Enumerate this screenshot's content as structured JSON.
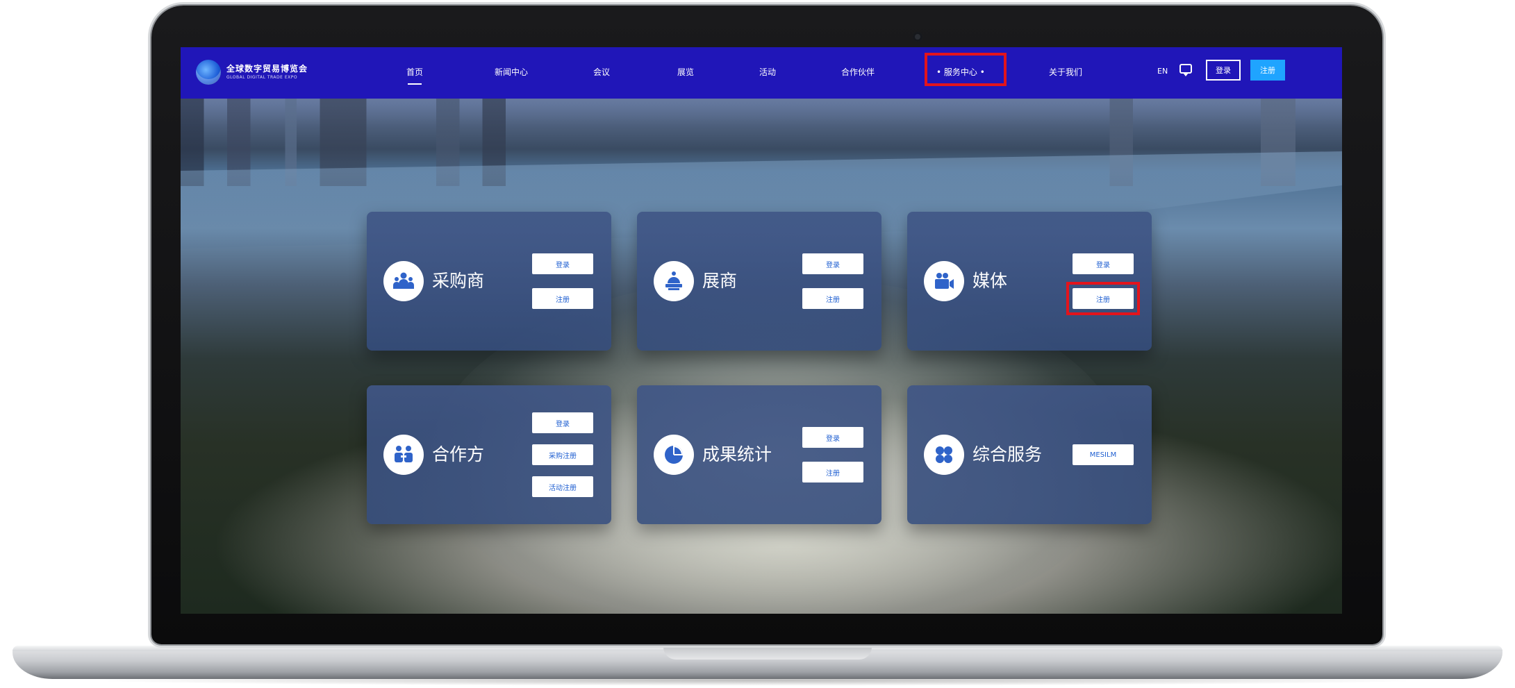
{
  "site": {
    "logo_cn": "全球数字贸易博览会",
    "logo_en": "GLOBAL DIGITAL TRADE EXPO"
  },
  "nav": {
    "items": [
      {
        "label": "首页"
      },
      {
        "label": "新闻中心"
      },
      {
        "label": "会议"
      },
      {
        "label": "展览"
      },
      {
        "label": "活动"
      },
      {
        "label": "合作伙伴"
      },
      {
        "label": "• 服务中心 •"
      },
      {
        "label": "关于我们"
      }
    ],
    "lang": "EN",
    "login": "登录",
    "register": "注册"
  },
  "cards": [
    {
      "title": "采购商",
      "buttons": [
        "登录",
        "注册"
      ]
    },
    {
      "title": "展商",
      "buttons": [
        "登录",
        "注册"
      ]
    },
    {
      "title": "媒体",
      "buttons": [
        "登录",
        "注册"
      ]
    },
    {
      "title": "合作方",
      "buttons": [
        "登录",
        "采购注册",
        "活动注册"
      ]
    },
    {
      "title": "成果统计",
      "buttons": [
        "登录",
        "注册"
      ]
    },
    {
      "title": "综合服务",
      "buttons": [
        "MESILM"
      ]
    }
  ],
  "colors": {
    "nav_bg": "#2016b8",
    "register_bg": "#1fa4ff",
    "highlight": "#e3141c",
    "card_button_text": "#1f5fd1"
  },
  "icons": {
    "buyer": "people-group-icon",
    "exhibitor": "cake-booth-icon",
    "media": "video-camera-icon",
    "partner": "handshake-people-icon",
    "results": "pie-chart-icon",
    "services": "four-leaf-icon"
  }
}
